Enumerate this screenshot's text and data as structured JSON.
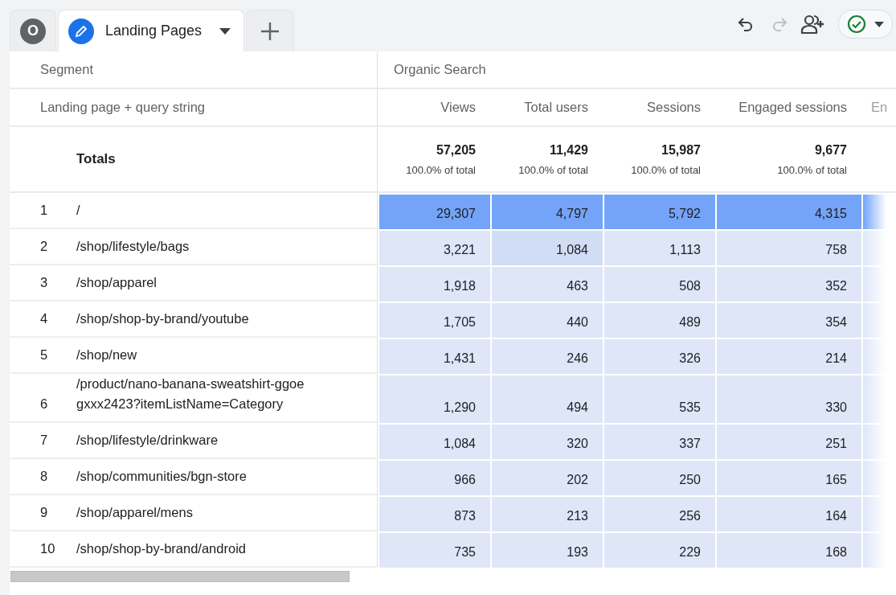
{
  "tabs": [
    {
      "kind": "avatar",
      "label": "O",
      "selected": false
    },
    {
      "kind": "report",
      "label": "Landing Pages",
      "selected": true
    }
  ],
  "toolbar": [
    {
      "kind": "undo",
      "disabled": false
    },
    {
      "kind": "redo",
      "disabled": true
    },
    {
      "kind": "share",
      "disabled": false
    }
  ],
  "status": {
    "checked": true
  },
  "table": {
    "segment_label": "Segment",
    "segment": "Organic Search",
    "dimension_header": "Landing page + query string",
    "metric_columns": [
      "Views",
      "Total users",
      "Sessions",
      "Engaged sessions",
      "En"
    ],
    "totals": {
      "label": "Totals",
      "values": [
        {
          "value": "57,205",
          "share": "100.0% of total"
        },
        {
          "value": "11,429",
          "share": "100.0% of total"
        },
        {
          "value": "15,987",
          "share": "100.0% of total"
        },
        {
          "value": "9,677",
          "share": "100.0% of total"
        }
      ]
    },
    "rows": [
      {
        "rank": "1",
        "page": "/",
        "cells": [
          {
            "value": "29,307",
            "color": "#74a4f8"
          },
          {
            "value": "4,797",
            "color": "#74a4f8"
          },
          {
            "value": "5,792",
            "color": "#74a4f8"
          },
          {
            "value": "4,315",
            "color": "#74a4f8"
          }
        ]
      },
      {
        "rank": "2",
        "page": "/shop/lifestyle/bags",
        "cells": [
          {
            "value": "3,221",
            "color": "#dfe6f8"
          },
          {
            "value": "1,084",
            "color": "#d0ddf5"
          },
          {
            "value": "1,113",
            "color": "#dfe6f8"
          },
          {
            "value": "758",
            "color": "#dfe6f8"
          }
        ]
      },
      {
        "rank": "3",
        "page": "/shop/apparel",
        "cells": [
          {
            "value": "1,918",
            "color": "#dfe6f8"
          },
          {
            "value": "463",
            "color": "#dfe6f8"
          },
          {
            "value": "508",
            "color": "#dfe6f8"
          },
          {
            "value": "352",
            "color": "#dfe6f8"
          }
        ]
      },
      {
        "rank": "4",
        "page": "/shop/shop-by-brand/youtube",
        "cells": [
          {
            "value": "1,705",
            "color": "#dfe6f8"
          },
          {
            "value": "440",
            "color": "#dfe6f8"
          },
          {
            "value": "489",
            "color": "#dfe6f8"
          },
          {
            "value": "354",
            "color": "#dfe6f8"
          }
        ]
      },
      {
        "rank": "5",
        "page": "/shop/new",
        "cells": [
          {
            "value": "1,431",
            "color": "#dfe6f8"
          },
          {
            "value": "246",
            "color": "#dfe6f8"
          },
          {
            "value": "326",
            "color": "#dfe6f8"
          },
          {
            "value": "214",
            "color": "#dfe6f8"
          }
        ]
      },
      {
        "rank": "6",
        "page": "/product/nano-banana-sweatshirt-ggoegxxx2423?itemListName=Category",
        "cells": [
          {
            "value": "1,290",
            "color": "#dfe6f8"
          },
          {
            "value": "494",
            "color": "#dfe6f8"
          },
          {
            "value": "535",
            "color": "#dfe6f8"
          },
          {
            "value": "330",
            "color": "#dfe6f8"
          }
        ]
      },
      {
        "rank": "7",
        "page": "/shop/lifestyle/drinkware",
        "cells": [
          {
            "value": "1,084",
            "color": "#dfe6f8"
          },
          {
            "value": "320",
            "color": "#dfe6f8"
          },
          {
            "value": "337",
            "color": "#dfe6f8"
          },
          {
            "value": "251",
            "color": "#dfe6f8"
          }
        ]
      },
      {
        "rank": "8",
        "page": "/shop/communities/bgn-store",
        "cells": [
          {
            "value": "966",
            "color": "#dfe6f8"
          },
          {
            "value": "202",
            "color": "#dfe6f8"
          },
          {
            "value": "250",
            "color": "#dfe6f8"
          },
          {
            "value": "165",
            "color": "#dfe6f8"
          }
        ]
      },
      {
        "rank": "9",
        "page": "/shop/apparel/mens",
        "cells": [
          {
            "value": "873",
            "color": "#dfe6f8"
          },
          {
            "value": "213",
            "color": "#dfe6f8"
          },
          {
            "value": "256",
            "color": "#dfe6f8"
          },
          {
            "value": "164",
            "color": "#dfe6f8"
          }
        ]
      },
      {
        "rank": "10",
        "page": "/shop/shop-by-brand/android",
        "cells": [
          {
            "value": "735",
            "color": "#dfe6f8"
          },
          {
            "value": "193",
            "color": "#dfe6f8"
          },
          {
            "value": "229",
            "color": "#dfe6f8"
          },
          {
            "value": "168",
            "color": "#dfe6f8"
          }
        ]
      }
    ]
  }
}
